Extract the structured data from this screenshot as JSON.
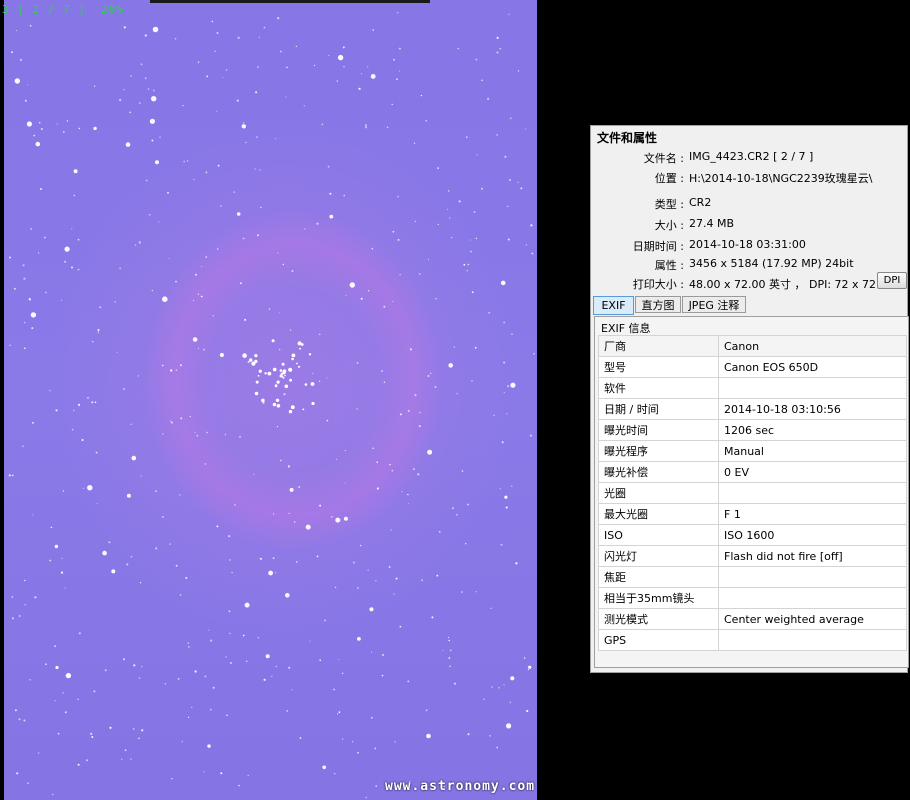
{
  "viewer": {
    "counter": "3 [ 2 / 7 ]  20%",
    "watermark": "www.astronomy.com"
  },
  "info": {
    "title": "文件和属性",
    "props": [
      {
        "label": "文件名 :",
        "value": "IMG_4423.CR2   [ 2 / 7 ]"
      },
      {
        "label": "位置 :",
        "value": "H:\\2014-10-18\\NGC2239玫瑰星云\\"
      },
      {
        "label": "类型 :",
        "value": "CR2"
      },
      {
        "label": "大小 :",
        "value": "27.4 MB"
      },
      {
        "label": "日期时间 :",
        "value": "2014-10-18 03:31:00"
      },
      {
        "label": "属性 :",
        "value": "3456 x 5184 (17.92 MP)  24bit"
      },
      {
        "label": "打印大小 :",
        "value": "48.00 x 72.00 英寸 ，  DPI: 72 x 72"
      }
    ],
    "dpi_label": "DPI"
  },
  "tabs": [
    "EXIF",
    "直方图",
    "JPEG 注释"
  ],
  "exif": {
    "header": "EXIF 信息",
    "rows": [
      {
        "k": "厂商",
        "v": "Canon"
      },
      {
        "k": "型号",
        "v": "Canon EOS 650D"
      },
      {
        "k": "软件",
        "v": ""
      },
      {
        "k": "日期 / 时间",
        "v": "2014-10-18 03:10:56"
      },
      {
        "k": "曝光时间",
        "v": "1206 sec"
      },
      {
        "k": "曝光程序",
        "v": "Manual"
      },
      {
        "k": "曝光补偿",
        "v": "0 EV"
      },
      {
        "k": "光圈",
        "v": ""
      },
      {
        "k": "最大光圈",
        "v": "F 1"
      },
      {
        "k": "ISO",
        "v": "ISO 1600"
      },
      {
        "k": "闪光灯",
        "v": "Flash did not fire [off]"
      },
      {
        "k": "焦距",
        "v": ""
      },
      {
        "k": "相当于35mm镜头",
        "v": ""
      },
      {
        "k": "测光模式",
        "v": "Center weighted average"
      },
      {
        "k": "GPS",
        "v": ""
      }
    ]
  },
  "colors": {
    "viewer_bg": "#000000",
    "sky": "#8676e6",
    "counter": "#2dd24a",
    "active_tab": "#d9ecfa"
  }
}
